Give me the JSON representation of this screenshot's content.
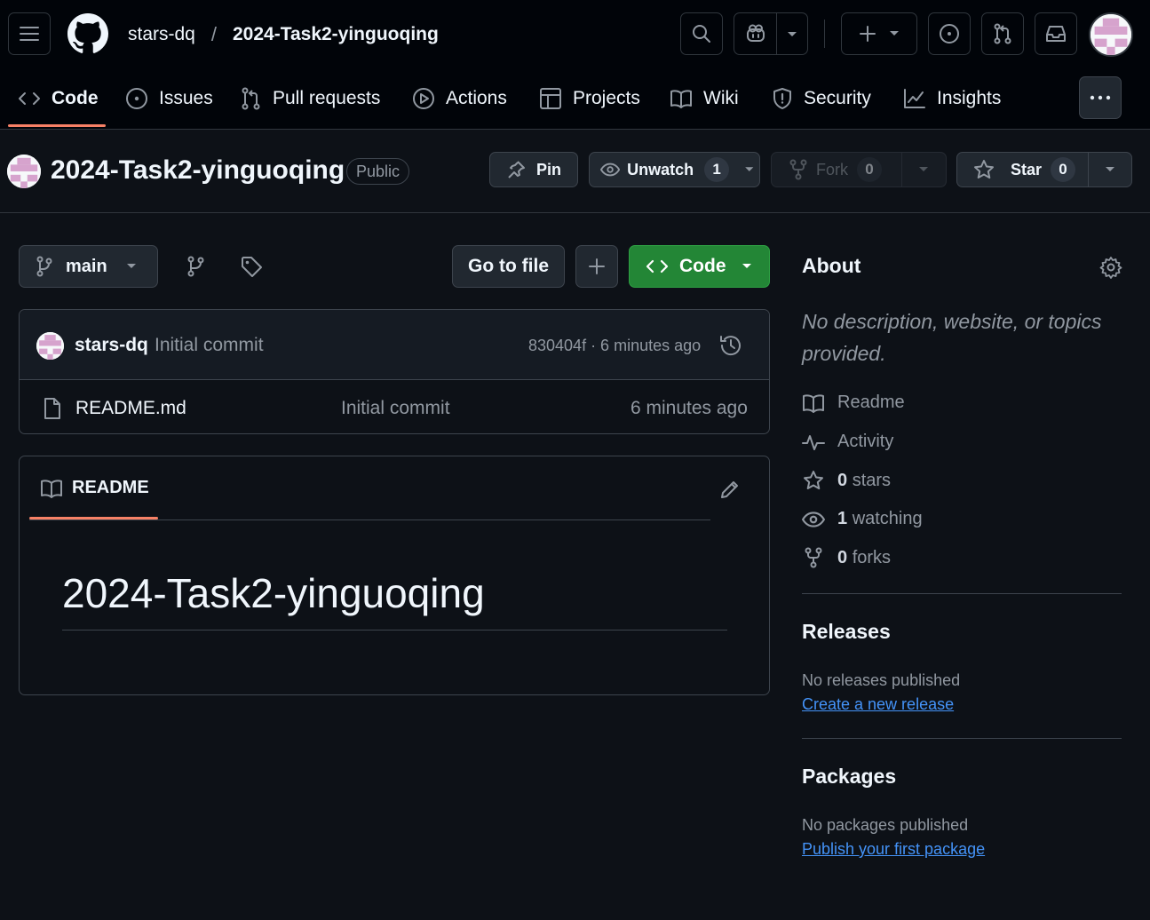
{
  "header": {
    "owner": "stars-dq",
    "separator": "/",
    "repo": "2024-Task2-yinguoqing"
  },
  "tabs": [
    {
      "label": "Code",
      "icon": "code-icon",
      "selected": true
    },
    {
      "label": "Issues",
      "icon": "issue-icon"
    },
    {
      "label": "Pull requests",
      "icon": "pull-request-icon"
    },
    {
      "label": "Actions",
      "icon": "play-icon"
    },
    {
      "label": "Projects",
      "icon": "table-icon"
    },
    {
      "label": "Wiki",
      "icon": "book-icon"
    },
    {
      "label": "Security",
      "icon": "shield-icon"
    },
    {
      "label": "Insights",
      "icon": "graph-icon"
    }
  ],
  "repo_header": {
    "name": "2024-Task2-yinguoqing",
    "visibility": "Public",
    "pin_label": "Pin",
    "unwatch_label": "Unwatch",
    "watch_count": "1",
    "fork_label": "Fork",
    "fork_count": "0",
    "star_label": "Star",
    "star_count": "0"
  },
  "file_nav": {
    "branch": "main",
    "go_to_file": "Go to file",
    "code_button": "Code"
  },
  "latest_commit": {
    "author": "stars-dq",
    "message": "Initial commit",
    "sha_time": "830404f · 6 minutes ago"
  },
  "files": [
    {
      "name": "README.md",
      "message": "Initial commit",
      "time": "6 minutes ago"
    }
  ],
  "readme": {
    "tab_label": "README",
    "heading": "2024-Task2-yinguoqing"
  },
  "about": {
    "title": "About",
    "description": "No description, website, or topics provided.",
    "readme": "Readme",
    "activity": "Activity",
    "stars_count": "0",
    "stars_label": "stars",
    "watching_count": "1",
    "watching_label": "watching",
    "forks_count": "0",
    "forks_label": "forks"
  },
  "releases": {
    "title": "Releases",
    "text": "No releases published",
    "link": "Create a new release"
  },
  "packages": {
    "title": "Packages",
    "text": "No packages published",
    "link": "Publish your first package"
  },
  "colors": {
    "background": "#0d1117",
    "header": "#010409",
    "accent_underline": "#f78166",
    "code_button": "#238636",
    "link": "#4493f8"
  }
}
